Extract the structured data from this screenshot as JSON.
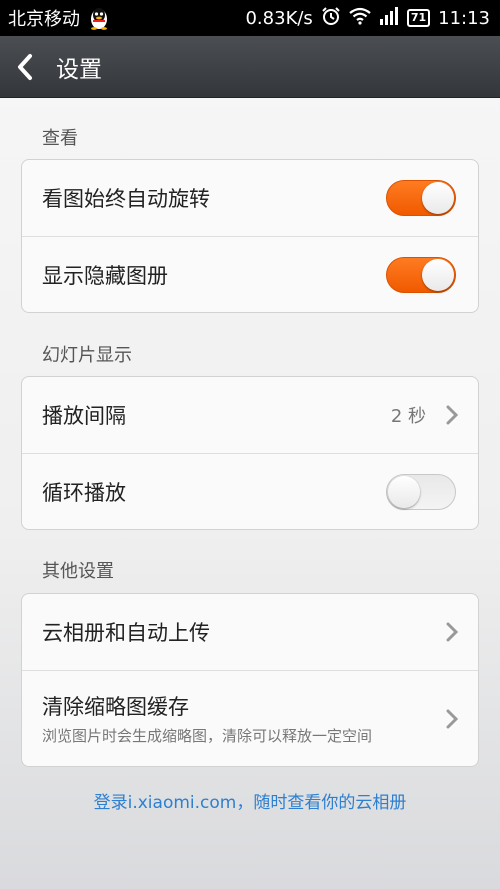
{
  "status_bar": {
    "carrier": "北京移动",
    "net_speed": "0.83K/s",
    "battery": "71",
    "time": "11:13"
  },
  "header": {
    "title": "设置"
  },
  "sections": {
    "view": {
      "label": "查看",
      "auto_rotate": {
        "label": "看图始终自动旋转",
        "enabled": true
      },
      "show_hidden": {
        "label": "显示隐藏图册",
        "enabled": true
      }
    },
    "slideshow": {
      "label": "幻灯片显示",
      "interval": {
        "label": "播放间隔",
        "value": "2 秒"
      },
      "loop": {
        "label": "循环播放",
        "enabled": false
      }
    },
    "other": {
      "label": "其他设置",
      "cloud": {
        "label": "云相册和自动上传"
      },
      "clear_cache": {
        "label": "清除缩略图缓存",
        "description": "浏览图片时会生成缩略图，清除可以释放一定空间"
      }
    }
  },
  "footer": {
    "link_text": "登录i.xiaomi.com，随时查看你的云相册"
  },
  "colors": {
    "accent_orange": "#f05a00",
    "link_blue": "#2d7fd0",
    "titlebar": "#3a3d41"
  }
}
